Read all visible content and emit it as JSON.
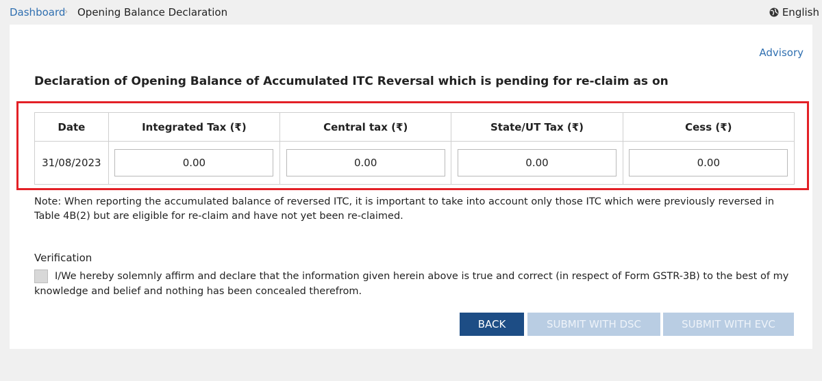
{
  "breadcrumb": {
    "home": "Dashboard",
    "separator": "›",
    "current": "Opening Balance Declaration"
  },
  "language": {
    "label": "English",
    "icon": "globe-icon"
  },
  "advisory_link": "Advisory",
  "heading": "Declaration of Opening Balance of Accumulated ITC Reversal which is pending for re-claim as on",
  "table": {
    "headers": [
      "Date",
      "Integrated Tax (₹)",
      "Central tax (₹)",
      "State/UT Tax (₹)",
      "Cess (₹)"
    ],
    "row": {
      "date": "31/08/2023",
      "integrated": "0.00",
      "central": "0.00",
      "state": "0.00",
      "cess": "0.00"
    }
  },
  "note": "Note: When reporting the accumulated balance of reversed ITC, it is important to take into account only those ITC which were previously reversed in Table 4B(2) but are eligible for re-claim and have not yet been re-claimed.",
  "verification": {
    "label": "Verification",
    "affirmation": "I/We hereby solemnly affirm and declare that the information given herein above is true and correct (in respect of Form GSTR-3B) to the best of my knowledge and belief and nothing has been concealed therefrom.",
    "checked": false
  },
  "buttons": {
    "back": "BACK",
    "submit_dsc": "SUBMIT WITH DSC",
    "submit_evc": "SUBMIT WITH EVC"
  },
  "colors": {
    "link": "#2f6fb0",
    "primary_button": "#1d4d85",
    "disabled_button": "#b9cde3",
    "highlight_border": "#e32026"
  }
}
